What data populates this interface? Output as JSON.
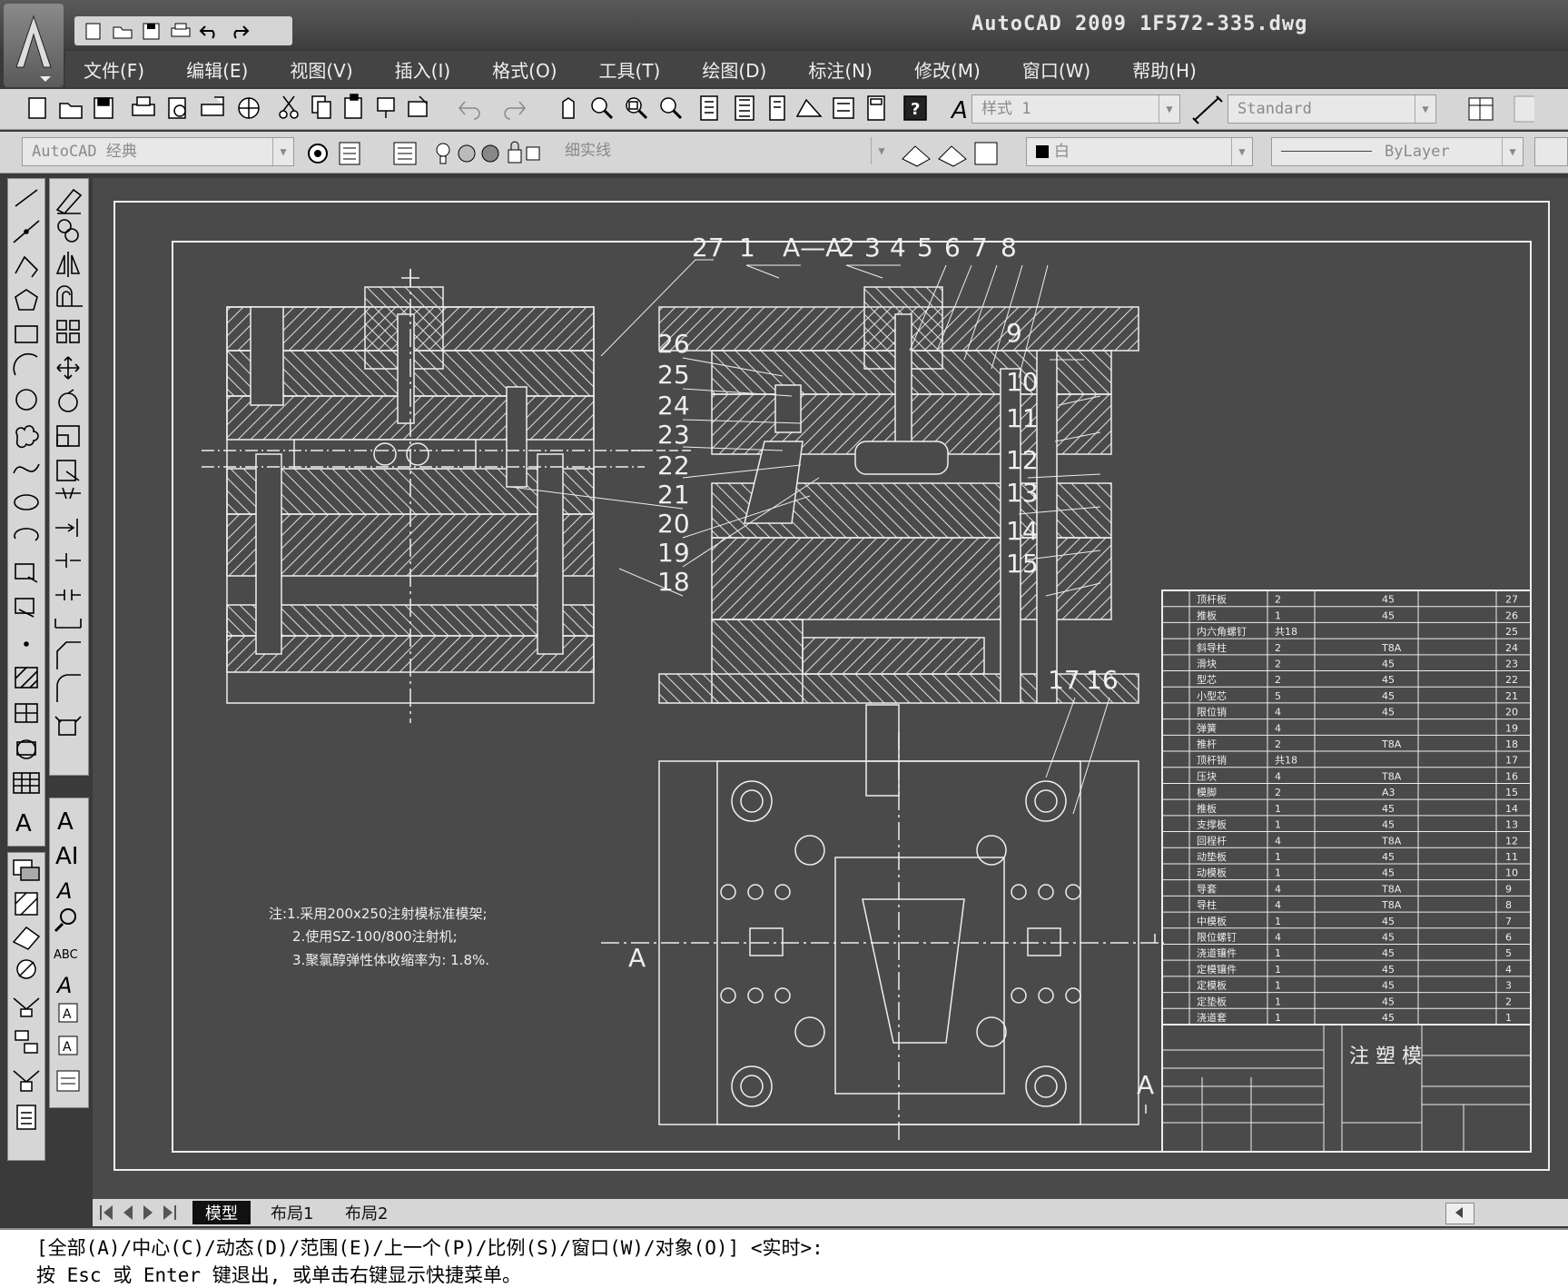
{
  "window": {
    "title": "AutoCAD  2009  1F572-335.dwg"
  },
  "menu": [
    "文件(F)",
    "编辑(E)",
    "视图(V)",
    "插入(I)",
    "格式(O)",
    "工具(T)",
    "绘图(D)",
    "标注(N)",
    "修改(M)",
    "窗口(W)",
    "帮助(H)"
  ],
  "toolbar": {
    "text_style": "样式 1",
    "dim_style": "Standard",
    "workspace": "AutoCAD 经典",
    "layer": "细实线",
    "color": "白",
    "linetype": "ByLayer"
  },
  "drawing": {
    "section_label": "A—A",
    "part_numbers_top": [
      "27",
      "1",
      "2",
      "3",
      "4",
      "5",
      "6",
      "7",
      "8"
    ],
    "part_numbers_right": [
      "9",
      "10",
      "11",
      "12",
      "13",
      "14",
      "15"
    ],
    "part_numbers_left": [
      "26",
      "25",
      "24",
      "23",
      "22",
      "21",
      "20",
      "19",
      "18"
    ],
    "part_numbers_plan": [
      "17",
      "16"
    ],
    "section_mark": "A",
    "notes": [
      "注:1.采用200x250注射模标准模架;",
      "2.使用SZ-100/800注射机;",
      "3.聚氯醇弹性体收缩率为: 1.8%."
    ],
    "title_block_name": "注 塑 模",
    "bom_rows": [
      {
        "no": "27",
        "name": "顶杆板",
        "qty": "2",
        "mat": "45"
      },
      {
        "no": "26",
        "name": "推板",
        "qty": "1",
        "mat": "45"
      },
      {
        "no": "25",
        "name": "内六角螺钉",
        "qty": "共18",
        "mat": ""
      },
      {
        "no": "24",
        "name": "斜导柱",
        "qty": "2",
        "mat": "T8A"
      },
      {
        "no": "23",
        "name": "滑块",
        "qty": "2",
        "mat": "45"
      },
      {
        "no": "22",
        "name": "型芯",
        "qty": "2",
        "mat": "45"
      },
      {
        "no": "21",
        "name": "小型芯",
        "qty": "5",
        "mat": "45"
      },
      {
        "no": "20",
        "name": "限位销",
        "qty": "4",
        "mat": "45"
      },
      {
        "no": "19",
        "name": "弹簧",
        "qty": "4",
        "mat": ""
      },
      {
        "no": "18",
        "name": "推杆",
        "qty": "2",
        "mat": "T8A"
      },
      {
        "no": "17",
        "name": "顶杆销",
        "qty": "共18",
        "mat": ""
      },
      {
        "no": "16",
        "name": "压块",
        "qty": "4",
        "mat": "T8A"
      },
      {
        "no": "15",
        "name": "模脚",
        "qty": "2",
        "mat": "A3"
      },
      {
        "no": "14",
        "name": "推板",
        "qty": "1",
        "mat": "45"
      },
      {
        "no": "13",
        "name": "支撑板",
        "qty": "1",
        "mat": "45"
      },
      {
        "no": "12",
        "name": "回程杆",
        "qty": "4",
        "mat": "T8A"
      },
      {
        "no": "11",
        "name": "动垫板",
        "qty": "1",
        "mat": "45"
      },
      {
        "no": "10",
        "name": "动模板",
        "qty": "1",
        "mat": "45"
      },
      {
        "no": "9",
        "name": "导套",
        "qty": "4",
        "mat": "T8A"
      },
      {
        "no": "8",
        "name": "导柱",
        "qty": "4",
        "mat": "T8A"
      },
      {
        "no": "7",
        "name": "中模板",
        "qty": "1",
        "mat": "45"
      },
      {
        "no": "6",
        "name": "限位螺钉",
        "qty": "4",
        "mat": "45"
      },
      {
        "no": "5",
        "name": "浇道镶件",
        "qty": "1",
        "mat": "45"
      },
      {
        "no": "4",
        "name": "定模镶件",
        "qty": "1",
        "mat": "45"
      },
      {
        "no": "3",
        "name": "定模板",
        "qty": "1",
        "mat": "45"
      },
      {
        "no": "2",
        "name": "定垫板",
        "qty": "1",
        "mat": "45"
      },
      {
        "no": "1",
        "name": "浇道套",
        "qty": "1",
        "mat": "45"
      }
    ]
  },
  "tabs": {
    "model": "模型",
    "layout1": "布局1",
    "layout2": "布局2"
  },
  "command": {
    "line1": "[全部(A)/中心(C)/动态(D)/范围(E)/上一个(P)/比例(S)/窗口(W)/对象(O)] <实时>:",
    "line2": "按 Esc 或 Enter 键退出, 或单击右键显示快捷菜单。"
  }
}
